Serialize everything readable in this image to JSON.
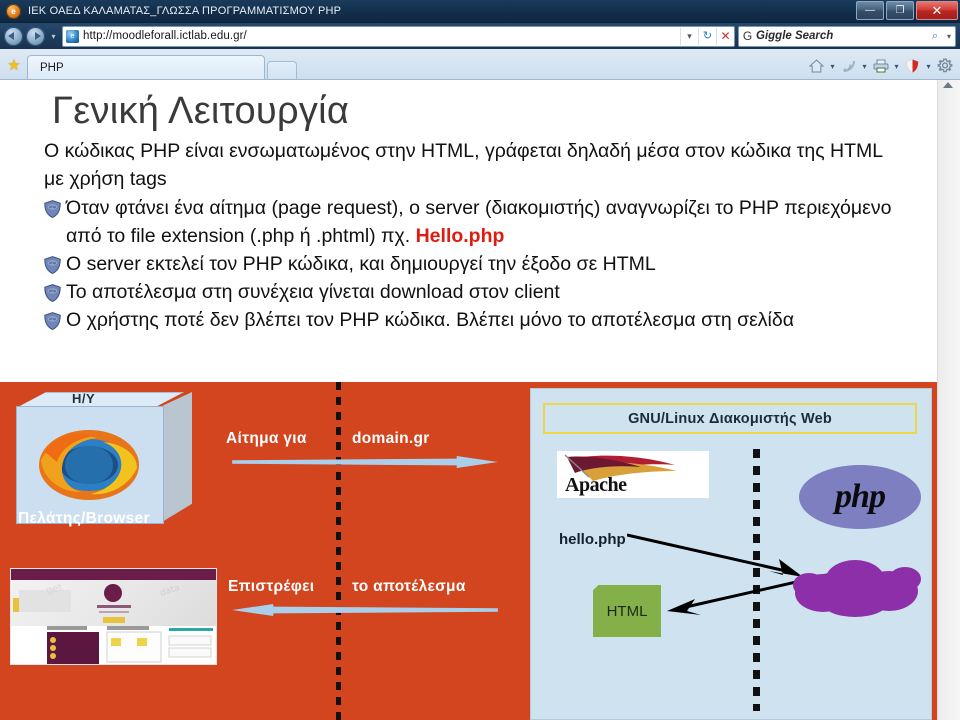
{
  "window": {
    "title": "ΙΕΚ ΟΑΕΔ ΚΑΛΑΜΑΤΑΣ_ΓΛΩΣΣΑ ΠΡΟΓΡΑΜΜΑΤΙΣΜΟΥ PHP",
    "app_icon": "browser-icon",
    "minimize_label": "—",
    "maximize_label": "❐",
    "close_label": "✕"
  },
  "navbar": {
    "back_icon": "back-arrow-icon",
    "forward_icon": "forward-arrow-icon",
    "history_caret": "▾",
    "address": {
      "favicon": "site-favicon",
      "url": "http://moodleforall.ictlab.edu.gr/",
      "dropdown_caret": "▾",
      "refresh_label": "↻",
      "stop_label": "✕"
    },
    "search": {
      "provider_icon": "G",
      "placeholder": "Giggle Search",
      "value": "Giggle Search",
      "go_label": "⌕",
      "caret": "▾"
    }
  },
  "tabbar": {
    "favorites_icon": "star-icon",
    "tabs": [
      {
        "label": "PHP",
        "active": true
      }
    ],
    "new_tab_label": "",
    "tools": [
      {
        "name": "home-icon",
        "glyph": "⌂",
        "caret": "▾"
      },
      {
        "name": "rss-feed-icon",
        "glyph": "≫",
        "caret": "▾"
      },
      {
        "name": "printer-icon",
        "glyph": "⎙",
        "caret": "▾"
      },
      {
        "name": "safety-shield-icon",
        "glyph": "◆",
        "caret": "▾"
      },
      {
        "name": "settings-gear-icon",
        "glyph": "⚙",
        "caret": ""
      }
    ]
  },
  "slide": {
    "title": "Γενική Λειτουργία",
    "paragraph": "Ο κώδικας PHP είναι ενσωματωμένος στην HTML, γράφεται  δηλαδή μέσα στον κώδικα της HTML με χρήση tags",
    "bullets": [
      {
        "icon": "php-shield-bullet-icon",
        "text": "Όταν φτάνει ένα αίτημα (page request), ο server (διακομιστής) αναγνωρίζει το PHP περιεχόμενο από το file extension (.php ή .phtml) πχ. ",
        "highlight": "Hello.php",
        "highlight_color": "#e01b10"
      },
      {
        "icon": "php-shield-bullet-icon",
        "text": "Ο server εκτελεί τον PHP κώδικα, και δημιουργεί την έξοδο σε HTML",
        "highlight": "",
        "highlight_color": ""
      },
      {
        "icon": "php-shield-bullet-icon",
        "text": "Το αποτέλεσμα στη συνέχεια γίνεται download στον client",
        "highlight": "",
        "highlight_color": ""
      },
      {
        "icon": "php-shield-bullet-icon",
        "text": "Ο χρήστης ποτέ δεν βλέπει τον PHP κώδικα. Βλέπει μόνο το αποτέλεσμα στη σελίδα",
        "highlight": "",
        "highlight_color": ""
      }
    ]
  },
  "diagram": {
    "background_color": "#d2451e",
    "client": {
      "box_label": "Η/Υ",
      "caption": "Πελάτης/Browser",
      "browser_icon": "firefox-logo-icon"
    },
    "request_arrow": {
      "label_left": "Αίτημα για",
      "label_right": "domain.gr",
      "direction": "right",
      "color": "#a9cfeb"
    },
    "response_arrow": {
      "label_left": "Επιστρέφει",
      "label_right": "το αποτέλεσμα",
      "direction": "left",
      "color": "#a9cfeb"
    },
    "result_thumbnail": "rendered-webpage-screenshot",
    "server": {
      "panel_color": "#cfe2ef",
      "title": "GNU/Linux Διακομιστής Web",
      "title_border_color": "#ecd64a",
      "apache_label": "Apache",
      "php_label": "php",
      "php_logo_color": "#7d7fc0",
      "file_label": "hello.php",
      "output_label": "HTML",
      "output_color": "#84b04a",
      "cloud_color": "#8c2fa8"
    }
  },
  "scrollbar": {
    "up_arrow": "scroll-up-arrow-icon",
    "down_arrow": "scroll-down-arrow-icon"
  }
}
